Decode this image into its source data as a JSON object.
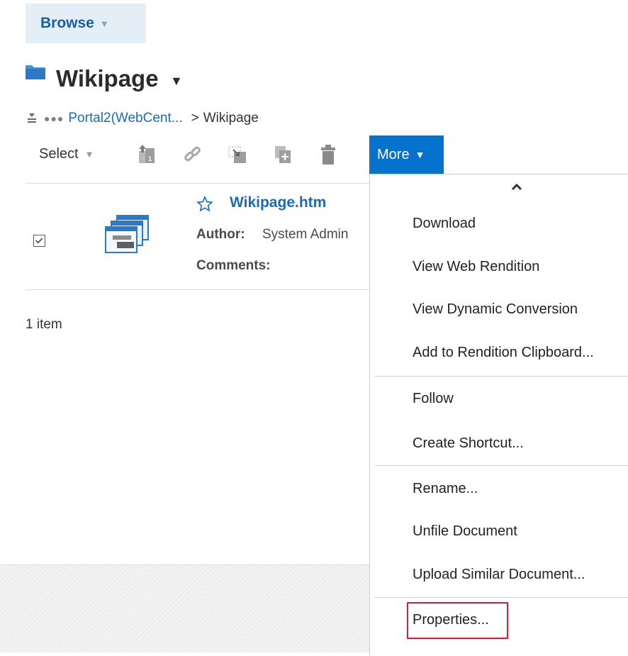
{
  "browse_tab": {
    "label": "Browse"
  },
  "page": {
    "title": "Wikipage"
  },
  "breadcrumb": {
    "dots": "●●●",
    "parent": "Portal2(WebCent...",
    "separator": ">",
    "current": "Wikipage"
  },
  "toolbar": {
    "select_label": "Select",
    "more_label": "More",
    "icons": [
      "upload-icon",
      "link-icon",
      "move-icon",
      "copy-icon",
      "delete-icon"
    ]
  },
  "document": {
    "name": "Wikipage.htm",
    "author_label": "Author:",
    "author_value": "System Admin",
    "comments_label": "Comments:",
    "comments_value": "",
    "checked": true
  },
  "item_count": "1 item",
  "menu": {
    "items": [
      "Download",
      "View Web Rendition",
      "View Dynamic Conversion",
      "Add to Rendition Clipboard...",
      "Follow",
      "Create Shortcut...",
      "Rename...",
      "Unfile Document",
      "Upload Similar Document...",
      "Properties..."
    ]
  },
  "colors": {
    "accent": "#0572ce",
    "link": "#1b6bb5",
    "highlight": "#d21f3a"
  }
}
